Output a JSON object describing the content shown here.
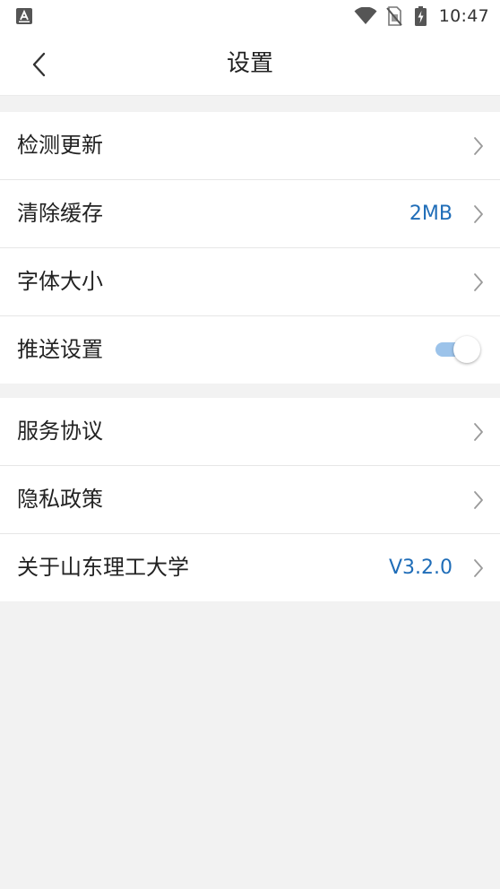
{
  "status_bar": {
    "time": "10:47",
    "app_icon": "a-box-icon",
    "icons": [
      "wifi-icon",
      "no-sim-icon",
      "battery-charging-icon"
    ]
  },
  "header": {
    "back_icon": "chevron-left-icon",
    "title": "设置"
  },
  "settings": {
    "group1": [
      {
        "label": "检测更新",
        "value": ""
      },
      {
        "label": "清除缓存",
        "value": "2MB"
      },
      {
        "label": "字体大小",
        "value": ""
      },
      {
        "label": "推送设置",
        "toggle_on": true
      }
    ],
    "group2": [
      {
        "label": "服务协议",
        "value": ""
      },
      {
        "label": "隐私政策",
        "value": ""
      },
      {
        "label": "关于山东理工大学",
        "value": "V3.2.0"
      }
    ]
  },
  "colors": {
    "accent": "#1f6db8",
    "toggle_track": "#9cc3ea",
    "background": "#f2f2f2",
    "card": "#ffffff"
  }
}
